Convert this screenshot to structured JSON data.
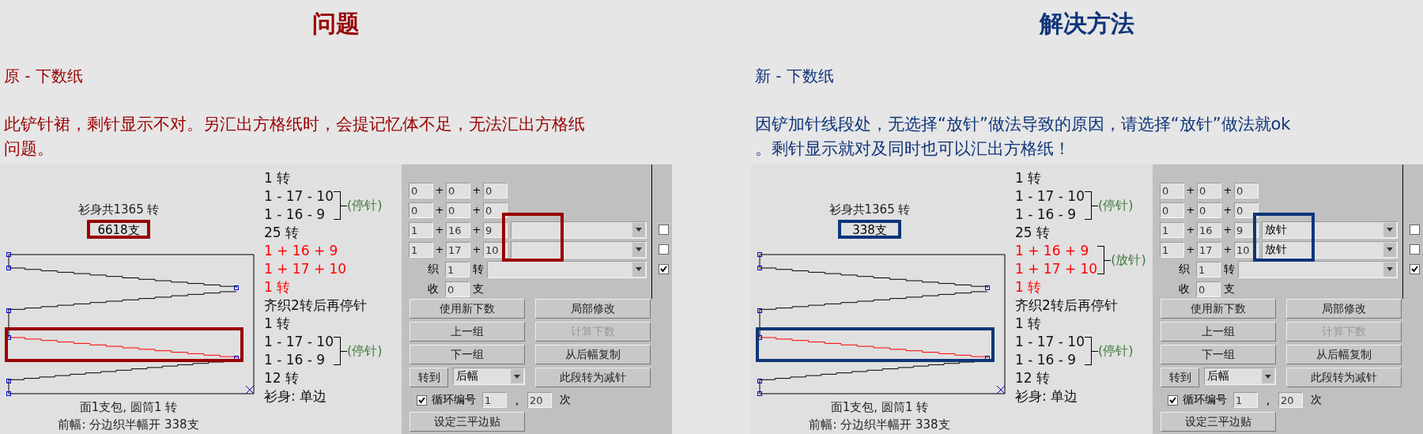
{
  "panels": [
    {
      "color": "#990000",
      "title": "问题",
      "subtitle": "原 - 下数纸",
      "description": [
        "此铲针裙，剩针显示不对。另汇出方格纸时，会提记忆体不足，无法汇出方格纸",
        "问题。"
      ],
      "drawing": {
        "total": "衫身共1365 转",
        "count": "6618支",
        "footer": [
          "面1支包, 圆筒1 转",
          "前幅: 分边织半幅开 338支"
        ],
        "notes": [
          {
            "kind": "line",
            "text": "1 转",
            "emphasis": false
          },
          {
            "kind": "group",
            "lines": [
              "1 - 17 - 10",
              "1 - 16 - 9"
            ],
            "label": "(停针)",
            "emphasis": false
          },
          {
            "kind": "line",
            "text": "25 转",
            "emphasis": false
          },
          {
            "kind": "line",
            "text": "1 + 16 + 9",
            "emphasis": true
          },
          {
            "kind": "line",
            "text": "1 + 17 + 10",
            "emphasis": true
          },
          {
            "kind": "line",
            "text": "1 转",
            "emphasis": true
          },
          {
            "kind": "line",
            "text": "齐织2转后再停针",
            "emphasis": false
          },
          {
            "kind": "line",
            "text": "1 转",
            "emphasis": false
          },
          {
            "kind": "group",
            "lines": [
              "1 - 17 - 10",
              "1 - 16 - 9"
            ],
            "label": "(停针)",
            "emphasis": false
          },
          {
            "kind": "line",
            "text": "12 转",
            "emphasis": false
          },
          {
            "kind": "line",
            "text": "衫身: 单边",
            "emphasis": false
          }
        ]
      },
      "form": {
        "rows": [
          {
            "kind": "sum",
            "operator": "+",
            "values": [
              "0",
              "0",
              "0"
            ]
          },
          {
            "kind": "sum",
            "operator": "+",
            "values": [
              "0",
              "0",
              "0"
            ]
          },
          {
            "kind": "select",
            "operator": "+",
            "values": [
              "1",
              "16",
              "9"
            ],
            "checked": false
          },
          {
            "kind": "select",
            "operator": "+",
            "values": [
              "1",
              "17",
              "10"
            ],
            "checked": false
          }
        ],
        "knit": {
          "label": "织",
          "value": "1",
          "unit": "转",
          "checked": true
        },
        "cast": {
          "label": "收",
          "value": "0",
          "unit": "支"
        },
        "buttons": [
          {
            "label": "使用新下数",
            "disabled": false
          },
          {
            "label": "局部修改",
            "disabled": false
          },
          {
            "label": "上一组",
            "disabled": false
          },
          {
            "label": "计算下数",
            "disabled": true
          },
          {
            "label": "下一组",
            "disabled": false
          },
          {
            "label": "从后幅复制",
            "disabled": false
          }
        ],
        "goto": {
          "label": "转到",
          "value": "后幅",
          "button": "此段转为减针"
        },
        "loop": {
          "label": "循环编号",
          "checked": true,
          "from": "1",
          "separator": ",",
          "to": "20",
          "unit": "次"
        },
        "last_button": "设定三平边贴"
      }
    },
    {
      "color": "#0f3579",
      "title": "解决方法",
      "subtitle": "新 - 下数纸",
      "description": [
        "因铲加针线段处，无选择“放针”做法导致的原因，请选择“放针”做法就ok",
        "。剩针显示就对及同时也可以汇出方格纸！"
      ],
      "drawing": {
        "total": "衫身共1365 转",
        "count": "338支",
        "footer": [
          "面1支包, 圆筒1 转",
          "前幅: 分边织半幅开 338支"
        ],
        "notes": [
          {
            "kind": "line",
            "text": "1 转",
            "emphasis": false
          },
          {
            "kind": "group",
            "lines": [
              "1 - 17 - 10",
              "1 - 16 - 9"
            ],
            "label": "(停针)",
            "emphasis": false
          },
          {
            "kind": "line",
            "text": "25 转",
            "emphasis": false
          },
          {
            "kind": "group",
            "lines": [
              "1 + 16 + 9",
              "1 + 17 + 10"
            ],
            "label": "(放针)",
            "emphasis": true
          },
          {
            "kind": "line",
            "text": "1 转",
            "emphasis": true
          },
          {
            "kind": "line",
            "text": "齐织2转后再停针",
            "emphasis": false
          },
          {
            "kind": "line",
            "text": "1 转",
            "emphasis": false
          },
          {
            "kind": "group",
            "lines": [
              "1 - 17 - 10",
              "1 - 16 - 9"
            ],
            "label": "(停针)",
            "emphasis": false
          },
          {
            "kind": "line",
            "text": "12 转",
            "emphasis": false
          },
          {
            "kind": "line",
            "text": "衫身: 单边",
            "emphasis": false
          }
        ]
      },
      "form": {
        "rows": [
          {
            "kind": "sum",
            "operator": "+",
            "values": [
              "0",
              "0",
              "0"
            ]
          },
          {
            "kind": "sum",
            "operator": "+",
            "values": [
              "0",
              "0",
              "0"
            ]
          },
          {
            "kind": "select",
            "operator": "+",
            "values": [
              "1",
              "16",
              "9"
            ],
            "method": "放针",
            "checked": false
          },
          {
            "kind": "select",
            "operator": "+",
            "values": [
              "1",
              "17",
              "10"
            ],
            "method": "放针",
            "checked": false
          }
        ],
        "knit": {
          "label": "织",
          "value": "1",
          "unit": "转",
          "checked": true
        },
        "cast": {
          "label": "收",
          "value": "0",
          "unit": "支"
        },
        "buttons": [
          {
            "label": "使用新下数",
            "disabled": false
          },
          {
            "label": "局部修改",
            "disabled": false
          },
          {
            "label": "上一组",
            "disabled": false
          },
          {
            "label": "计算下数",
            "disabled": true
          },
          {
            "label": "下一组",
            "disabled": false
          },
          {
            "label": "从后幅复制",
            "disabled": false
          }
        ],
        "goto": {
          "label": "转到",
          "value": "后幅",
          "button": "此段转为减针"
        },
        "loop": {
          "label": "循环编号",
          "checked": true,
          "from": "1",
          "separator": ",",
          "to": "20",
          "unit": "次"
        },
        "last_button": "设定三平边贴"
      }
    }
  ]
}
